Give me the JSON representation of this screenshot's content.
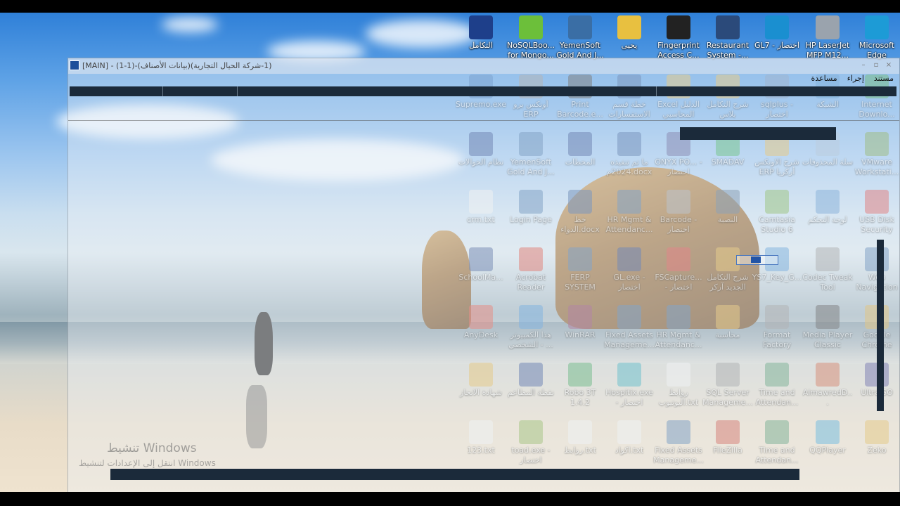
{
  "window": {
    "title": "[MAIN] - (1-1)-(بيانات الأصناف)(1-شركة الحيال التجارية)",
    "controls": [
      "–",
      "▫",
      "×"
    ],
    "menu": [
      "مستند",
      "إجراء",
      "مساعدة"
    ]
  },
  "activation": {
    "title": "تنشيط Windows",
    "subtitle": "انتقل إلى الإعدادات لتنشيط Windows"
  },
  "icons": [
    {
      "label": "التكامل",
      "color": "#1e3f8a"
    },
    {
      "label": "NoSQLBoo... for Mongo...",
      "color": "#6cbf3a"
    },
    {
      "label": "YemenSoft Gold And J...",
      "color": "#3a6ea5"
    },
    {
      "label": "يحيى",
      "color": "#e8c040"
    },
    {
      "label": "Fingerprint Access C...",
      "color": "#222222"
    },
    {
      "label": "Restaurant System -...",
      "color": "#2b4a7a"
    },
    {
      "label": "GL7 - اختصار",
      "color": "#1a8fd0"
    },
    {
      "label": "HP LaserJet MFP M12...",
      "color": "#9aa3ad"
    },
    {
      "label": "Microsoft Edge",
      "color": "#1d9bd6"
    },
    {
      "label": "Supremo.exe",
      "color": "#2d6bb5"
    },
    {
      "label": "أونكس برو ERP",
      "color": "#8a8a8a"
    },
    {
      "label": "Print Barcode.e...",
      "color": "#333333"
    },
    {
      "label": "خطة قسم الاستفسارات",
      "color": "#2b5797"
    },
    {
      "label": "Excel الدليل المحاسبي",
      "color": "#e0b040"
    },
    {
      "label": "شرح التكامل بلاس",
      "color": "#e0b040"
    },
    {
      "label": "sqlplus - اختصار",
      "color": "#6a8ab5"
    },
    {
      "label": "الشبكة",
      "color": "#3a86c8"
    },
    {
      "label": "Internet Downlo...",
      "color": "#2a9a3a"
    },
    {
      "label": "نظام الحوالات",
      "color": "#1e3f8a"
    },
    {
      "label": "YemenSoft Gold And J...",
      "color": "#3a6ea5"
    },
    {
      "label": "المحطات",
      "color": "#1e3f8a"
    },
    {
      "label": "ما تم تنفيذه 2024م.docx",
      "color": "#2b5797"
    },
    {
      "label": "ONYX PO... - اختصار",
      "color": "#4a4a8a"
    },
    {
      "label": "SMADAV",
      "color": "#2aa84a"
    },
    {
      "label": "شرح الاونكس ERP أركريا",
      "color": "#e0b040"
    },
    {
      "label": "سلة المحذوفات",
      "color": "#9ab5cf"
    },
    {
      "label": "VMware Workstati...",
      "color": "#6a9a3a"
    },
    {
      "label": "crm.txt",
      "color": "#f2f2f2"
    },
    {
      "label": "Login Page",
      "color": "#3a6ea5"
    },
    {
      "label": "خط الدواء.docx",
      "color": "#2b5797"
    },
    {
      "label": "HR Mgmt & Attendanc...",
      "color": "#3a6ea5"
    },
    {
      "label": "Barcode - اختصار",
      "color": "#9aa3ad"
    },
    {
      "label": "النصبة",
      "color": "#4a6a8a"
    },
    {
      "label": "Camtasia Studio 6",
      "color": "#6aa83a"
    },
    {
      "label": "لوحة التحكم",
      "color": "#4a8ac8"
    },
    {
      "label": "USB Disk Security",
      "color": "#d83a3a"
    },
    {
      "label": "SchoolMa...",
      "color": "#2b4a8a"
    },
    {
      "label": "Acrobat Reader",
      "color": "#d83a2a"
    },
    {
      "label": "FERP SYSTEM",
      "color": "#3a6ea5"
    },
    {
      "label": "GL.exe - اختصار",
      "color": "#1e3f8a"
    },
    {
      "label": "FSCapture... - اختصار",
      "color": "#d83a3a"
    },
    {
      "label": "شرح التكامل الجديد آركر",
      "color": "#e0b040"
    },
    {
      "label": "YS7_Key_G...",
      "color": "#3a8ad0"
    },
    {
      "label": "Codec Tweak Tool",
      "color": "#8a8a8a"
    },
    {
      "label": "Web Navigation",
      "color": "#3a6ea5"
    },
    {
      "label": "AnyDesk",
      "color": "#e04a3a"
    },
    {
      "label": "هذا الكمبيوتر الشخصي - ...",
      "color": "#3a8ad0"
    },
    {
      "label": "WinRAR",
      "color": "#8a3a6a"
    },
    {
      "label": "Fixed Assets Manageme...",
      "color": "#3a6ea5"
    },
    {
      "label": "HR Mgmt & Attendanc...",
      "color": "#3a6ea5"
    },
    {
      "label": "محاسبة",
      "color": "#e0b040"
    },
    {
      "label": "Format Factory",
      "color": "#8a8a8a"
    },
    {
      "label": "Media Player Classic",
      "color": "#3a3a3a"
    },
    {
      "label": "Google Chrome",
      "color": "#d8a83a"
    },
    {
      "label": "شهادة الانجاز",
      "color": "#e0b040"
    },
    {
      "label": "نقطة المطاعم",
      "color": "#1e3f8a"
    },
    {
      "label": "Robo 3T 1.4.2",
      "color": "#2a9a4a"
    },
    {
      "label": "Hospitix.exe - اختصار",
      "color": "#1aa0b0"
    },
    {
      "label": "روابط اليوتيوب.txt",
      "color": "#f2f2f2"
    },
    {
      "label": "SQL Server Manageme...",
      "color": "#8a8a8a"
    },
    {
      "label": "Time and Attendan...",
      "color": "#3a8a5a"
    },
    {
      "label": "AlmawredD...",
      "color": "#c8502a"
    },
    {
      "label": "UltraISO",
      "color": "#3a3a8a"
    },
    {
      "label": "123.txt",
      "color": "#f2f2f2"
    },
    {
      "label": "toad.exe - اختصار",
      "color": "#7aa83a"
    },
    {
      "label": "روابط.txt",
      "color": "#f2f2f2"
    },
    {
      "label": "اكواد.txt",
      "color": "#f2f2f2"
    },
    {
      "label": "Fixed Assets Manageme...",
      "color": "#3a6ea5"
    },
    {
      "label": "FileZilla",
      "color": "#c83a2a"
    },
    {
      "label": "Time and Attendan...",
      "color": "#3a8a5a"
    },
    {
      "label": "QQPlayer",
      "color": "#2a9ad0"
    },
    {
      "label": "Zeko",
      "color": "#e0b040"
    }
  ]
}
